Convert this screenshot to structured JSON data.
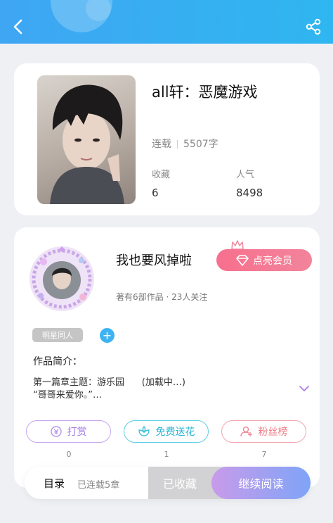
{
  "header": {
    "back_icon": "chevron-left-icon",
    "share_icon": "share-icon",
    "color": "#3fa6f3"
  },
  "book": {
    "title": "all轩：恶魔游戏",
    "status": "连载",
    "word_count": "5507字",
    "collect_label": "收藏",
    "collect_value": "6",
    "popularity_label": "人气",
    "popularity_value": "8498"
  },
  "author": {
    "name": "我也要风掉啦",
    "meta": "著有6部作品 · 23人关注",
    "vip_button": "点亮会员",
    "tag": "明星同人",
    "intro_title": "作品简介：",
    "intro_text": "第一篇章主题：游乐园      (加载中…)\n“哥哥来爱你。”…"
  },
  "actions": {
    "tip_label": "打赏",
    "tip_count": "0",
    "flower_label": "免费送花",
    "flower_count": "1",
    "fans_label": "粉丝榜",
    "fans_count": "7"
  },
  "bottom": {
    "catalog": "目录",
    "chapters": "已连载5章",
    "collected": "已收藏",
    "read": "继续阅读"
  }
}
